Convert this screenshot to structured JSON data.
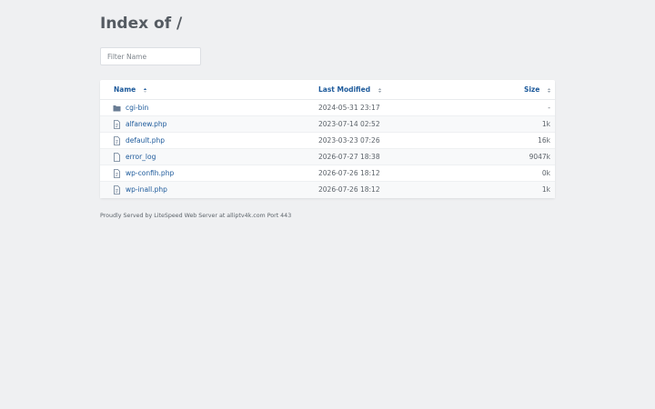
{
  "page": {
    "title": "Index of /",
    "filter_placeholder": "Filter Name",
    "footer": "Proudly Served by LiteSpeed Web Server at alliptv4k.com Port 443"
  },
  "table": {
    "headers": {
      "name": "Name",
      "modified": "Last Modified",
      "size": "Size"
    },
    "rows": [
      {
        "name": "cgi-bin",
        "icon": "folder-icon",
        "modified": "2024-05-31 23:17",
        "size": "-"
      },
      {
        "name": "alfanew.php",
        "icon": "file-text-icon",
        "modified": "2023-07-14 02:52",
        "size": "1k"
      },
      {
        "name": "default.php",
        "icon": "file-text-icon",
        "modified": "2023-03-23 07:26",
        "size": "16k"
      },
      {
        "name": "error_log",
        "icon": "file-icon",
        "modified": "2026-07-27 18:38",
        "size": "9047k"
      },
      {
        "name": "wp-confih.php",
        "icon": "file-text-icon",
        "modified": "2026-07-26 18:12",
        "size": "0k"
      },
      {
        "name": "wp-inall.php",
        "icon": "file-text-icon",
        "modified": "2026-07-26 18:12",
        "size": "1k"
      }
    ]
  },
  "colors": {
    "link": "#1d5a9b",
    "background": "#eff0f2",
    "icon": "#6a7d94"
  }
}
